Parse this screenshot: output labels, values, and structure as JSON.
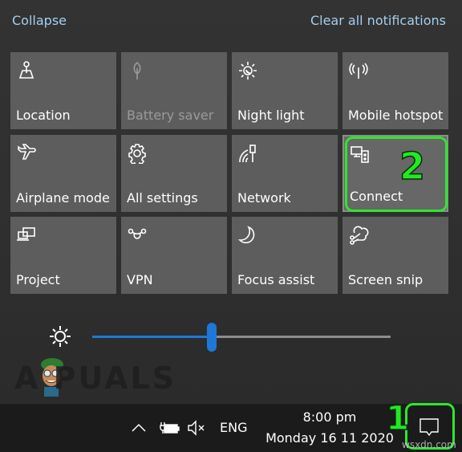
{
  "header": {
    "collapse_label": "Collapse",
    "clear_label": "Clear all notifications"
  },
  "tiles": [
    {
      "label": "Location",
      "icon": "location-icon",
      "state": "enabled"
    },
    {
      "label": "Battery saver",
      "icon": "leaf-icon",
      "state": "disabled"
    },
    {
      "label": "Night light",
      "icon": "night-light-icon",
      "state": "enabled"
    },
    {
      "label": "Mobile hotspot",
      "icon": "hotspot-icon",
      "state": "enabled"
    },
    {
      "label": "Airplane mode",
      "icon": "airplane-icon",
      "state": "enabled"
    },
    {
      "label": "All settings",
      "icon": "gear-icon",
      "state": "enabled"
    },
    {
      "label": "Network",
      "icon": "network-icon",
      "state": "enabled"
    },
    {
      "label": "Connect",
      "icon": "connect-icon",
      "state": "highlighted"
    },
    {
      "label": "Project",
      "icon": "project-icon",
      "state": "enabled"
    },
    {
      "label": "VPN",
      "icon": "vpn-icon",
      "state": "enabled"
    },
    {
      "label": "Focus assist",
      "icon": "moon-icon",
      "state": "enabled"
    },
    {
      "label": "Screen snip",
      "icon": "screen-snip-icon",
      "state": "enabled"
    }
  ],
  "brightness": {
    "icon": "brightness-icon",
    "value_fraction": 0.4
  },
  "watermark": {
    "text": "A PUALS",
    "site": "wsxdn.com"
  },
  "annotations": {
    "step1": "1",
    "step2": "2",
    "color": "#2ee62e"
  },
  "taskbar": {
    "language": "ENG",
    "time": "8:00 pm",
    "date": "Monday 16 11 2020",
    "tray_icons": [
      "chevron-up-icon",
      "battery-charging-icon",
      "volume-muted-icon"
    ],
    "action_center_icon": "action-center-icon"
  },
  "colors": {
    "link": "#a6cdf0",
    "accent": "#1e78d8",
    "tile": "#5d5d5d",
    "taskbar": "#1b1b1b"
  }
}
